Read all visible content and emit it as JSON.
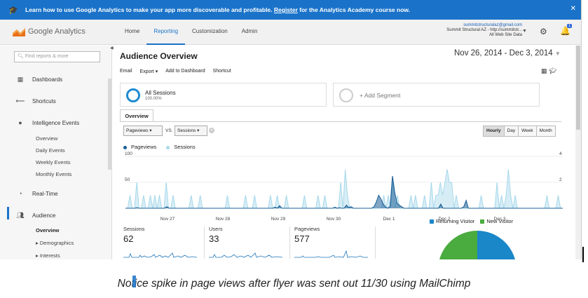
{
  "banner": {
    "text_before": "Learn how to use Google Analytics to make your app more discoverable and profitable. ",
    "link": "Register",
    "text_after": " for the Analytics Academy course now.",
    "close": "✕"
  },
  "header": {
    "logo_text": "Google Analytics",
    "nav": [
      "Home",
      "Reporting",
      "Customization",
      "Admin"
    ],
    "active_nav": "Reporting",
    "account_email": "summitstructuralaz@gmail.com",
    "account_property": "Summit Structural AZ - http://summitstr...",
    "account_view": "All Web Site Data",
    "notification_count": "1"
  },
  "sidebar": {
    "search_placeholder": "Find reports & more",
    "items": [
      {
        "label": "Dashboards",
        "icon": "grid-icon"
      },
      {
        "label": "Shortcuts",
        "icon": "shortcut-arrow-icon"
      },
      {
        "label": "Intelligence Events",
        "icon": "lightbulb-icon"
      },
      {
        "label": "Real-Time",
        "icon": "clock-icon"
      },
      {
        "label": "Audience",
        "icon": "people-icon"
      }
    ],
    "intelligence_sub": [
      "Overview",
      "Daily Events",
      "Weekly Events",
      "Monthly Events"
    ],
    "audience_sub": [
      "Overview",
      "▸ Demographics",
      "▸ Interests"
    ]
  },
  "main": {
    "title": "Audience Overview",
    "date_range": "Nov 26, 2014 - Dec 3, 2014",
    "actions": [
      "Email",
      "Export ▾",
      "Add to Dashboard",
      "Shortcut"
    ],
    "segment_name": "All Sessions",
    "segment_pct": "100.00%",
    "add_segment": "+ Add Segment",
    "tab": "Overview",
    "metric_select_1": "Pageviews",
    "vs_label": "VS.",
    "metric_select_2": "Sessions",
    "granularity": [
      "Hourly",
      "Day",
      "Week",
      "Month"
    ],
    "granularity_active": "Hourly"
  },
  "chart_data": {
    "type": "area",
    "title": "",
    "x_labels": [
      "Nov 27",
      "Nov 28",
      "Nov 29",
      "Nov 30",
      "Dec 1",
      "Dec 2",
      "Dec 3"
    ],
    "y_left_ticks": [
      "100",
      "50"
    ],
    "y_right_ticks": [
      "4",
      "2"
    ],
    "ylim_left": [
      0,
      100
    ],
    "ylim_right": [
      0,
      4
    ],
    "series": [
      {
        "name": "Pageviews",
        "color": "#1b5f96",
        "values": [
          0,
          0,
          0,
          0,
          0,
          1,
          0,
          0,
          0,
          0,
          0,
          0,
          0,
          0,
          0,
          0,
          0,
          0,
          3,
          0,
          0,
          0,
          0,
          0,
          0,
          0,
          0,
          0,
          0,
          0,
          0,
          0,
          0,
          0,
          0,
          0,
          0,
          0,
          0,
          0,
          0,
          0,
          0,
          0,
          0,
          0,
          0,
          0,
          0,
          0,
          0,
          0,
          0,
          0,
          0,
          0,
          0,
          0,
          0,
          0,
          0,
          0,
          0,
          0,
          0,
          2,
          0,
          5,
          0,
          0,
          0,
          0,
          0,
          0,
          0,
          0,
          0,
          0,
          0,
          0,
          0,
          0,
          0,
          0,
          0,
          0,
          0,
          0,
          0,
          0,
          0,
          2,
          0,
          1,
          0,
          0,
          6,
          1,
          3,
          0,
          0,
          0,
          0,
          0,
          0,
          0,
          0,
          0,
          3,
          12,
          25,
          18,
          8,
          2,
          0,
          4,
          62,
          30,
          10,
          6,
          3,
          0,
          0,
          0,
          0,
          0,
          0,
          0,
          0,
          0,
          0,
          0,
          0,
          0,
          0,
          0,
          0,
          8,
          0,
          0,
          0,
          0,
          0,
          0,
          0,
          0,
          0,
          3,
          15,
          0,
          0,
          0,
          0,
          0,
          0,
          0,
          0,
          0,
          0,
          0,
          0,
          0,
          0,
          0,
          0,
          0,
          0,
          0,
          0,
          0,
          0,
          0,
          0,
          0,
          0,
          0,
          0,
          0,
          0,
          0,
          0,
          0,
          0,
          0,
          0,
          0,
          0,
          0,
          0,
          0,
          0
        ]
      },
      {
        "name": "Sessions",
        "color": "#a7d8ea",
        "values": [
          0,
          0,
          1,
          0,
          0,
          2,
          0,
          0,
          1,
          0,
          0,
          1,
          0,
          1,
          0,
          1,
          0,
          0,
          2,
          0,
          0,
          1,
          0,
          0,
          0,
          0,
          0,
          0,
          0,
          1,
          0,
          0,
          0,
          1,
          0,
          0,
          0,
          0,
          0,
          0,
          0,
          0,
          0,
          0,
          0,
          1,
          0,
          0,
          0,
          0,
          0,
          0,
          0,
          1,
          0,
          0,
          0,
          1,
          0,
          0,
          0,
          0,
          0,
          0,
          1,
          0,
          0,
          1,
          0,
          0,
          0,
          1,
          0,
          0,
          0,
          0,
          0,
          0,
          0,
          1,
          0,
          0,
          0,
          0,
          0,
          1,
          0,
          0,
          1,
          0,
          0,
          0,
          0,
          0,
          0,
          2,
          0,
          3,
          1,
          0,
          0,
          0,
          0,
          0,
          0,
          0,
          0,
          0,
          0,
          0,
          0,
          0,
          0,
          0,
          1,
          0,
          1,
          0,
          2,
          0,
          1,
          0,
          0,
          0,
          0,
          0,
          1,
          0,
          1,
          0,
          0,
          0,
          1,
          0,
          0,
          2,
          0,
          1,
          1,
          2,
          1,
          2,
          3,
          2,
          2,
          0,
          1,
          0,
          0,
          0,
          0,
          0,
          0,
          0,
          0,
          0,
          0,
          1,
          0,
          0,
          0,
          0,
          0,
          0,
          2,
          0,
          1,
          0,
          1,
          3,
          1,
          0,
          1,
          0,
          0,
          0,
          0,
          0,
          0,
          0,
          0,
          0,
          0,
          0,
          0,
          0,
          1,
          0,
          0,
          0,
          0,
          1,
          0,
          0
        ]
      }
    ]
  },
  "metrics": [
    {
      "label": "Sessions",
      "value": "62"
    },
    {
      "label": "Users",
      "value": "33"
    },
    {
      "label": "Pageviews",
      "value": "577"
    }
  ],
  "visitor_pie": {
    "legend": [
      "Returning Visitor",
      "New Visitor"
    ],
    "colors": [
      "#1a87c9",
      "#4aab3e"
    ],
    "values": [
      50,
      50
    ]
  },
  "caption": "Notice spike in page views after flyer was sent out 11/30 using MailChimp"
}
